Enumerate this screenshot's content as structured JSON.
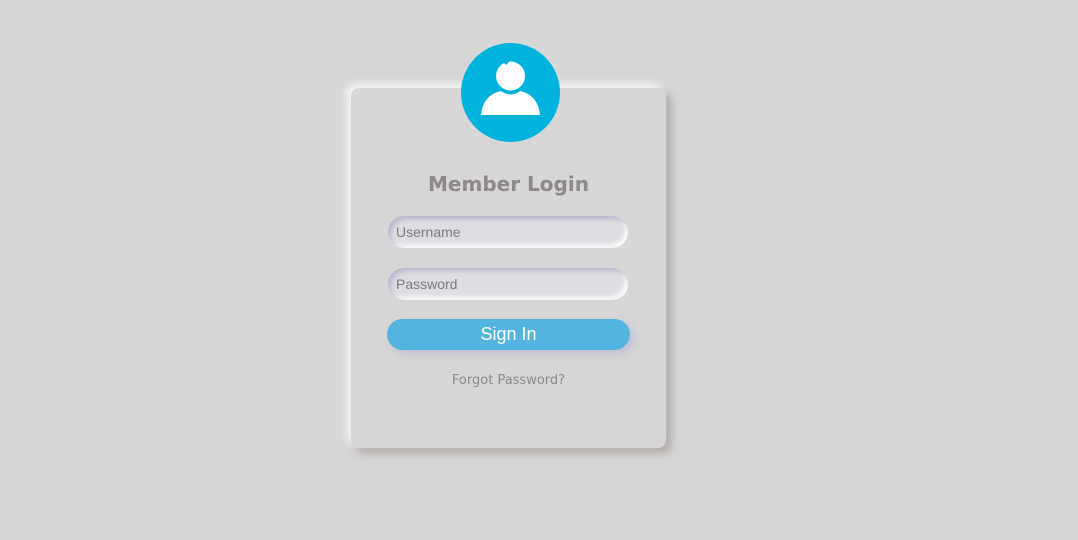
{
  "login": {
    "title": "Member Login",
    "username_placeholder": "Username",
    "password_placeholder": "Password",
    "signin_label": "Sign In",
    "forgot_label": "Forgot Password?"
  },
  "avatar": {
    "icon": "user-icon",
    "color": "#00b3dc"
  },
  "colors": {
    "background": "#d7d7d7",
    "accent": "#53b5df",
    "text": "#8e8888"
  }
}
